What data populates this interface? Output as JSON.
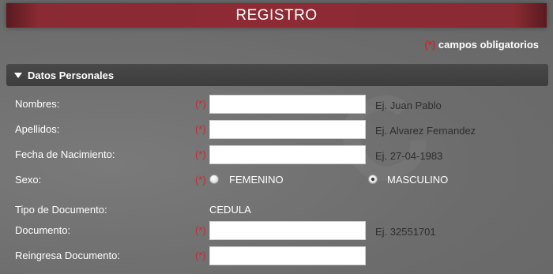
{
  "header": {
    "title": "REGISTRO"
  },
  "required_note": {
    "star": "(*)",
    "text": "campos obligatorios"
  },
  "section": {
    "title": "Datos Personales"
  },
  "form": {
    "nombres": {
      "label": "Nombres:",
      "required": "(*)",
      "value": "",
      "hint": "Ej. Juan Pablo"
    },
    "apellidos": {
      "label": "Apellidos:",
      "required": "(*)",
      "value": "",
      "hint": "Ej. Alvarez Fernandez"
    },
    "fecha_nacimiento": {
      "label": "Fecha de Nacimiento:",
      "required": "(*)",
      "value": "",
      "hint": "Ej. 27-04-1983"
    },
    "sexo": {
      "label": "Sexo:",
      "required": "(*)",
      "options": [
        "FEMENINO",
        "MASCULINO"
      ],
      "selected": "MASCULINO"
    },
    "tipo_documento": {
      "label": "Tipo de Documento:",
      "value": "CEDULA"
    },
    "documento": {
      "label": "Documento:",
      "required": "(*)",
      "value": "",
      "hint": "Ej. 32551701"
    },
    "reingresa_documento": {
      "label": "Reingresa Documento:",
      "required": "(*)",
      "value": ""
    }
  }
}
